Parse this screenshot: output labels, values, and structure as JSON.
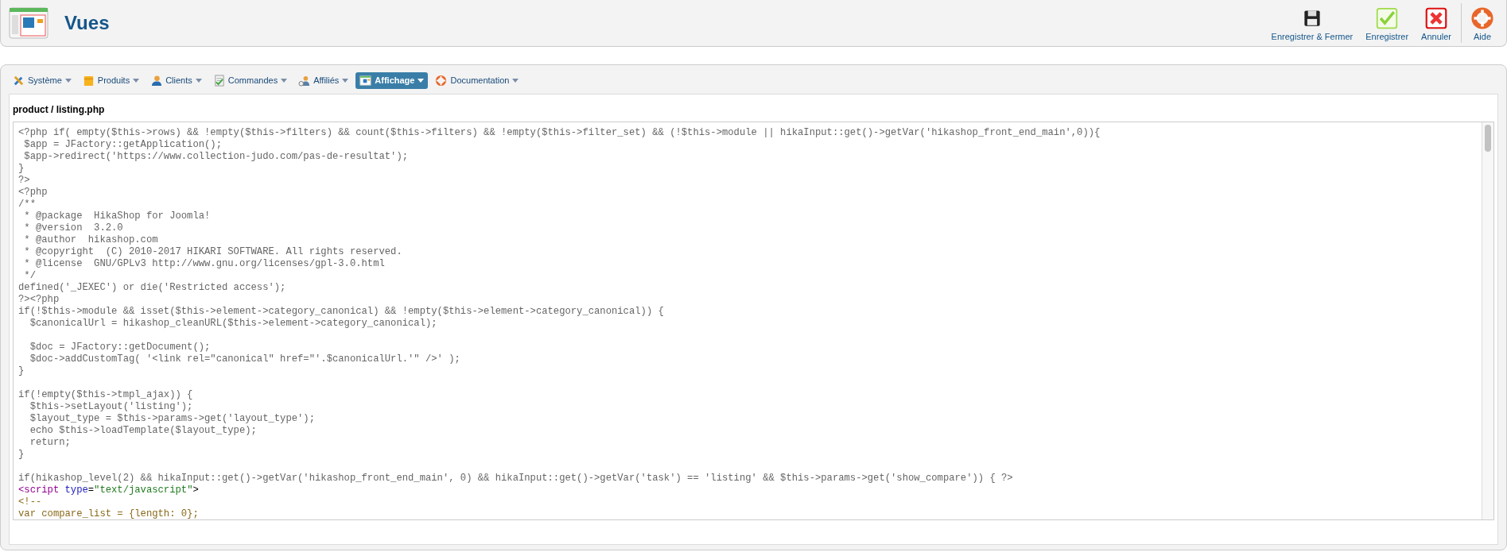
{
  "header": {
    "title": "Vues"
  },
  "toolbar": [
    {
      "label": "Enregistrer & Fermer",
      "kind": "save-close"
    },
    {
      "label": "Enregistrer",
      "kind": "save"
    },
    {
      "label": "Annuler",
      "kind": "cancel"
    },
    {
      "label": "Aide",
      "kind": "help"
    }
  ],
  "menu": [
    {
      "label": "Système",
      "kind": "tools",
      "selected": false
    },
    {
      "label": "Produits",
      "kind": "box",
      "selected": false
    },
    {
      "label": "Clients",
      "kind": "user",
      "selected": false
    },
    {
      "label": "Commandes",
      "kind": "doc",
      "selected": false
    },
    {
      "label": "Affiliés",
      "kind": "affiliate",
      "selected": false
    },
    {
      "label": "Affichage",
      "kind": "display",
      "selected": true
    },
    {
      "label": "Documentation",
      "kind": "help",
      "selected": false
    }
  ],
  "file_path": "product / listing.php",
  "code_lines": [
    {
      "kind": "php",
      "text": "<?php if( empty($this->rows) && !empty($this->filters) && count($this->filters) && !empty($this->filter_set) && (!$this->module || hikaInput::get()->getVar('hikashop_front_end_main',0)){"
    },
    {
      "kind": "php",
      "text": " $app = JFactory::getApplication();"
    },
    {
      "kind": "php",
      "text": " $app->redirect('https://www.collection-judo.com/pas-de-resultat');"
    },
    {
      "kind": "php",
      "text": "}"
    },
    {
      "kind": "php",
      "text": "?>"
    },
    {
      "kind": "php",
      "text": "<?php"
    },
    {
      "kind": "php",
      "text": "/**"
    },
    {
      "kind": "php",
      "text": " * @package  HikaShop for Joomla!"
    },
    {
      "kind": "php",
      "text": " * @version  3.2.0"
    },
    {
      "kind": "php",
      "text": " * @author  hikashop.com"
    },
    {
      "kind": "php",
      "text": " * @copyright  (C) 2010-2017 HIKARI SOFTWARE. All rights reserved."
    },
    {
      "kind": "php",
      "text": " * @license  GNU/GPLv3 http://www.gnu.org/licenses/gpl-3.0.html"
    },
    {
      "kind": "php",
      "text": " */"
    },
    {
      "kind": "php",
      "text": "defined('_JEXEC') or die('Restricted access');"
    },
    {
      "kind": "php",
      "text": "?><?php"
    },
    {
      "kind": "php",
      "text": "if(!$this->module && isset($this->element->category_canonical) && !empty($this->element->category_canonical)) {"
    },
    {
      "kind": "php",
      "text": "  $canonicalUrl = hikashop_cleanURL($this->element->category_canonical);"
    },
    {
      "kind": "php"
    },
    {
      "kind": "php",
      "text": "  $doc = JFactory::getDocument();"
    },
    {
      "kind": "php",
      "text": "  $doc->addCustomTag( '<link rel=\"canonical\" href=\"'.$canonicalUrl.'\" />' );"
    },
    {
      "kind": "php",
      "text": "}"
    },
    {
      "kind": "php"
    },
    {
      "kind": "php",
      "text": "if(!empty($this->tmpl_ajax)) {"
    },
    {
      "kind": "php",
      "text": "  $this->setLayout('listing');"
    },
    {
      "kind": "php",
      "text": "  $layout_type = $this->params->get('layout_type');"
    },
    {
      "kind": "php",
      "text": "  echo $this->loadTemplate($layout_type);"
    },
    {
      "kind": "php",
      "text": "  return;"
    },
    {
      "kind": "php",
      "text": "}"
    },
    {
      "kind": "php"
    },
    {
      "kind": "php",
      "text": "if(hikashop_level(2) && hikaInput::get()->getVar('hikashop_front_end_main', 0) && hikaInput::get()->getVar('task') == 'listing' && $this->params->get('show_compare')) { ?>"
    },
    {
      "kind": "markup",
      "parts": [
        {
          "kind": "tag",
          "text": "<script"
        },
        {
          "kind": "attr",
          "text": " type"
        },
        {
          "kind": "plain",
          "text": "="
        },
        {
          "kind": "string",
          "text": "\"text/javascript\""
        },
        {
          "kind": "plain",
          "text": ">"
        }
      ]
    },
    {
      "kind": "js",
      "text": "<!--"
    },
    {
      "kind": "js",
      "text": "var compare_list = {length: 0};"
    }
  ]
}
